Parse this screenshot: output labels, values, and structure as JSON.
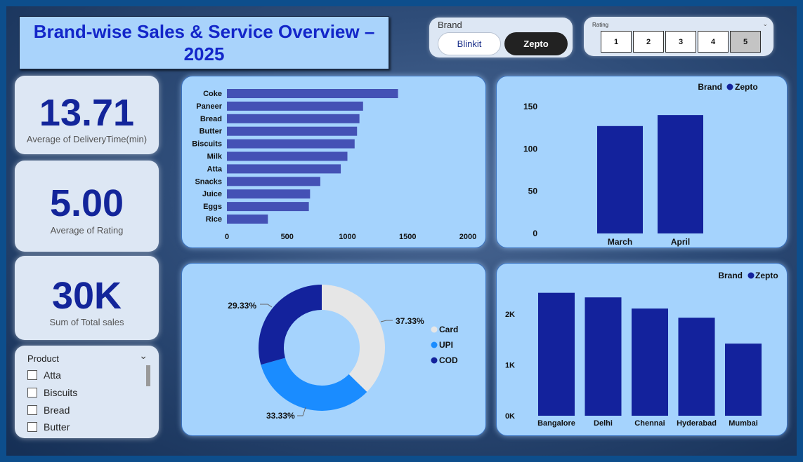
{
  "header": {
    "title": "Brand-wise Sales & Service Overview – 2025"
  },
  "brand_slicer": {
    "label": "Brand",
    "options": [
      "Blinkit",
      "Zepto"
    ],
    "selected": "Zepto"
  },
  "rating_slicer": {
    "label": "Rating",
    "options": [
      "1",
      "2",
      "3",
      "4",
      "5"
    ],
    "selected": "5"
  },
  "kpis": [
    {
      "value": "13.71",
      "label": "Average of DeliveryTime(min)"
    },
    {
      "value": "5.00",
      "label": "Average of Rating"
    },
    {
      "value": "30K",
      "label": "Sum of Total sales"
    }
  ],
  "product_slicer": {
    "label": "Product",
    "items": [
      "Atta",
      "Biscuits",
      "Bread",
      "Butter"
    ]
  },
  "colors": {
    "bar_product": "#4451b5",
    "bar_dark": "#13229c",
    "donut_card": "#e6e6e6",
    "donut_upi": "#1a8cff",
    "donut_cod": "#13229c"
  },
  "chart_data": [
    {
      "type": "bar",
      "orientation": "horizontal",
      "categories": [
        "Coke",
        "Paneer",
        "Bread",
        "Butter",
        "Biscuits",
        "Milk",
        "Atta",
        "Snacks",
        "Juice",
        "Eggs",
        "Rice"
      ],
      "values": [
        1420,
        1130,
        1100,
        1080,
        1060,
        1000,
        945,
        775,
        690,
        680,
        340
      ],
      "xticks": [
        "0",
        "500",
        "1000",
        "1500",
        "2000"
      ],
      "xlim": [
        0,
        2000
      ]
    },
    {
      "type": "bar",
      "categories": [
        "March",
        "April"
      ],
      "values": [
        127,
        140
      ],
      "yticks": [
        "0",
        "50",
        "100",
        "150"
      ],
      "ylim": [
        0,
        160
      ],
      "legend": {
        "title": "Brand",
        "entries": [
          "Zepto"
        ],
        "position": "top-right"
      }
    },
    {
      "type": "pie",
      "donut": true,
      "labels": [
        "Card",
        "UPI",
        "COD"
      ],
      "values": [
        37.33,
        33.33,
        29.33
      ],
      "value_labels": [
        "37.33%",
        "33.33%",
        "29.33%"
      ],
      "legend": {
        "entries": [
          "Card",
          "UPI",
          "COD"
        ],
        "position": "right"
      }
    },
    {
      "type": "bar",
      "categories": [
        "Bangalore",
        "Delhi",
        "Chennai",
        "Hyderabad",
        "Mumbai"
      ],
      "values": [
        2420,
        2330,
        2110,
        1930,
        1420
      ],
      "yticks": [
        "0K",
        "1K",
        "2K"
      ],
      "ylim": [
        0,
        2650
      ],
      "legend": {
        "title": "Brand",
        "entries": [
          "Zepto"
        ],
        "position": "top-right"
      }
    }
  ]
}
